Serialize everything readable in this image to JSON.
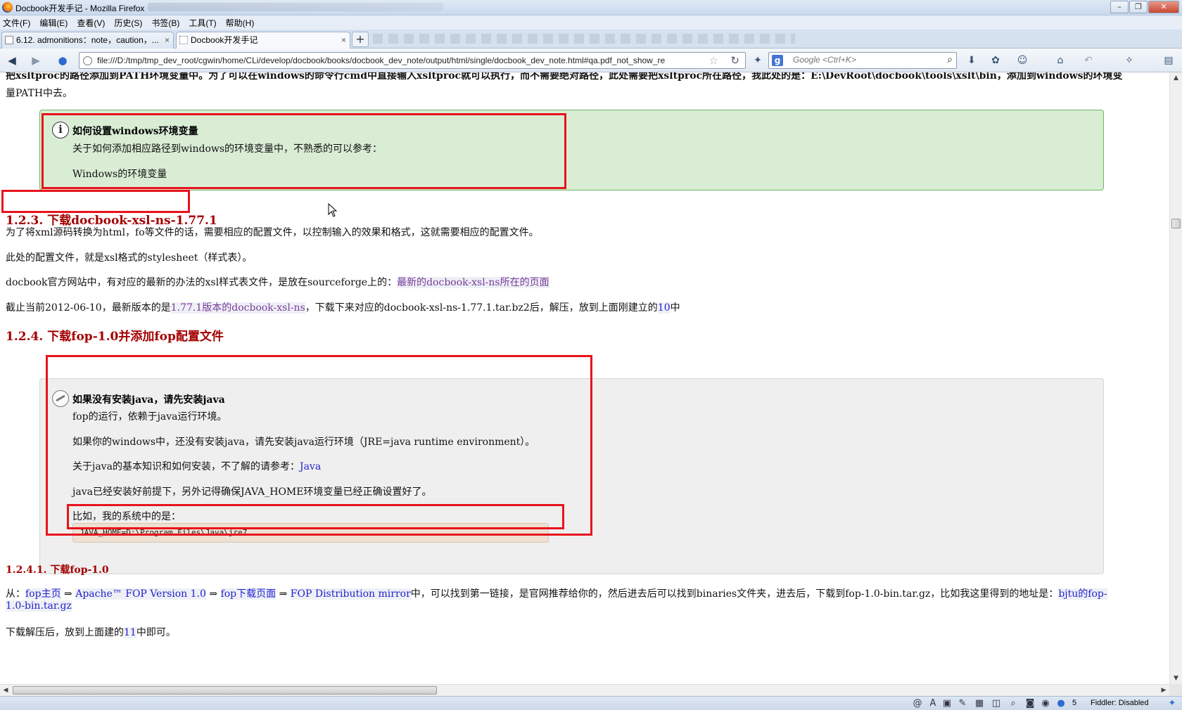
{
  "window": {
    "title": "Docbook开发手记 - Mozilla Firefox"
  },
  "menu": [
    "文件(F)",
    "编辑(E)",
    "查看(V)",
    "历史(S)",
    "书签(B)",
    "工具(T)",
    "帮助(H)"
  ],
  "tabs": [
    {
      "label": "6.12. admonitions：note，caution，..."
    },
    {
      "label": "Docbook开发手记"
    }
  ],
  "nav": {
    "url": "file:///D:/tmp/tmp_dev_root/cgwin/home/CLi/develop/docbook/books/docbook_dev_note/output/html/single/docbook_dev_note.html#qa.pdf_not_show_re",
    "search_placeholder": "Google <Ctrl+K>"
  },
  "content": {
    "top_line1": "把xsltproc的路径添加到PATH环境变量中。为了可以在windows的命令行cmd中直接输入xsltproc就可以执行，而不需要绝对路径，此处需要把xsltproc所在路径，我此处的是：E:\\DevRoot\\docbook\\tools\\xslt\\bin，添加到windows的环境变",
    "top_line2": "量PATH中去。",
    "tip": {
      "title": "如何设置windows环境变量",
      "body": "关于如何添加相应路径到windows的环境变量中，不熟悉的可以参考：",
      "link": "Windows的环境变量"
    },
    "h_123": "1.2.3. 下载docbook-xsl-ns-1.77.1",
    "p1": "为了将xml源码转换为html，fo等文件的话，需要相应的配置文件，以控制输入的效果和格式，这就需要相应的配置文件。",
    "p2": "此处的配置文件，就是xsl格式的stylesheet（样式表）。",
    "p3_pre": "docbook官方网站中，有对应的最新的办法的xsl样式表文件，是放在sourceforge上的：",
    "p3_link": "最新的docbook-xsl-ns所在的页面",
    "p4_pre": "截止当前2012-06-10，最新版本的是",
    "p4_link": "1.77.1版本的docbook-xsl-ns",
    "p4_mid": "，下载下来对应的docbook-xsl-ns-1.77.1.tar.bz2后，解压，放到上面刚建立的",
    "p4_ref": "10",
    "p4_end": "中",
    "h_124": "1.2.4. 下载fop-1.0并添加fop配置文件",
    "note": {
      "title": "如果没有安装java，请先安装java",
      "l1": "fop的运行，依赖于java运行环境。",
      "l2": "如果你的windows中，还没有安装java，请先安装java运行环境（JRE=java runtime environment）。",
      "l3_pre": "关于java的基本知识和如何安装，不了解的请参考：",
      "l3_link": "Java",
      "l4": "java已经安装好前提下，另外记得确保JAVA_HOME环境变量已经正确设置好了。",
      "l5": "比如，我的系统中的是：",
      "code": "JAVA_HOME=D:\\Program Files\\Java\\jre7"
    },
    "h_1241": "1.2.4.1. 下载fop-1.0",
    "p5_pre": "从：",
    "p5_l1": "fop主页",
    "p5_arrow": " ⇒ ",
    "p5_l2": "Apache™ FOP Version 1.0",
    "p5_l3": "fop下载页面",
    "p5_l4": "FOP Distribution mirror",
    "p5_mid": "中，可以找到第一链接，是官网推荐给你的，然后进去后可以找到binaries文件夹，进去后，下载到fop-1.0-bin.tar.gz，比如我这里得到的地址是：",
    "p5_l5a": "bjtu的fop-",
    "p5_l5b": "1.0-bin.tar.gz",
    "p6_pre": "下载解压后，放到上面建的",
    "p6_ref": "11",
    "p6_end": "中即可。"
  },
  "status": {
    "count": "5",
    "fiddler": "Fiddler: Disabled"
  }
}
